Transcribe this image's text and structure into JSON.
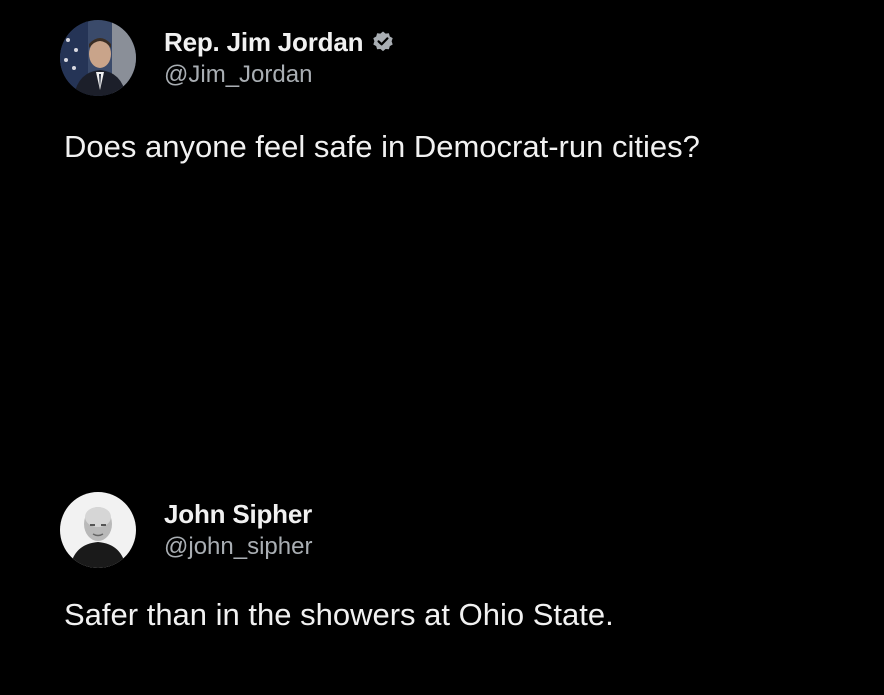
{
  "posts": [
    {
      "display_name": "Rep. Jim Jordan",
      "verified": true,
      "handle": "@Jim_Jordan",
      "text": "Does anyone feel safe in Democrat-run cities?",
      "avatar_icon": "profile-photo-man-in-suit"
    },
    {
      "display_name": "John Sipher",
      "verified": false,
      "handle": "@john_sipher",
      "text": "Safer than in the showers at Ohio State.",
      "avatar_icon": "profile-photo-bald-man"
    }
  ],
  "colors": {
    "background": "#000000",
    "primary_text": "#f1f1f1",
    "secondary_text": "#a9aeb3",
    "verified_badge": "#a9aeb3"
  }
}
